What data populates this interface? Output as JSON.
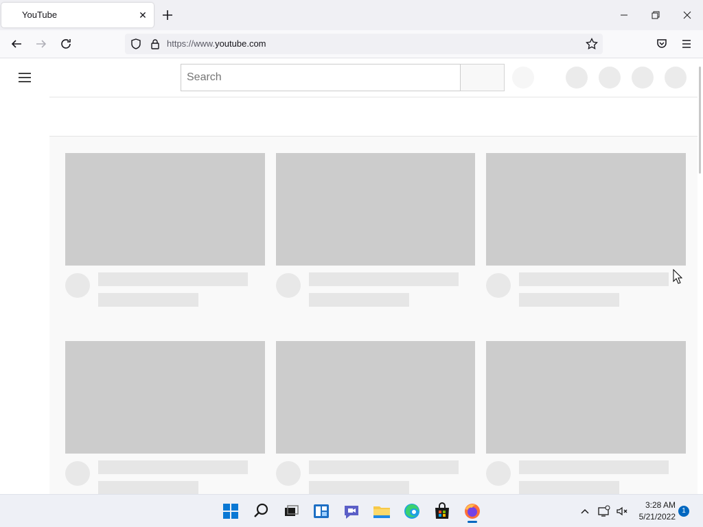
{
  "browser": {
    "tab_title": "YouTube",
    "tab_close": "✕",
    "url_prefix": "https://www.",
    "url_host": "youtube.com"
  },
  "youtube": {
    "search_placeholder": "Search"
  },
  "taskbar": {
    "time": "3:28 AM",
    "date": "5/21/2022",
    "notification_count": "1"
  },
  "colors": {
    "skeleton_thumb": "#cccccc",
    "skeleton_line": "#e6e6e6",
    "accent": "#0067c0"
  }
}
